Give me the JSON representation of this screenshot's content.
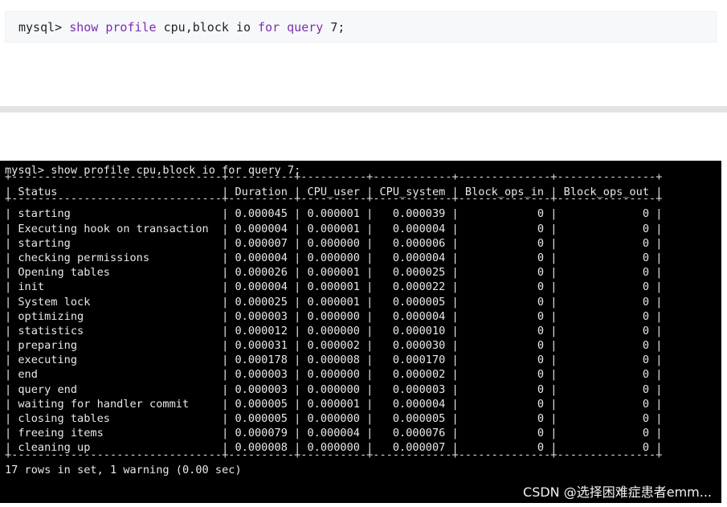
{
  "code_block": {
    "prompt": "mysql> ",
    "keyword_show": "show",
    "space1": " ",
    "keyword_profile": "profile",
    "args": " cpu,block io ",
    "keyword_for": "for",
    "space2": " ",
    "keyword_query": "query",
    "tail": " 7;"
  },
  "terminal": {
    "command_line": "mysql> show profile cpu,block io for query 7;",
    "separator_line": "+--------------------------------+----------+----------+------------+--------------+---------------+",
    "header_line": "| Status                         | Duration | CPU_user | CPU_system | Block_ops_in | Block_ops_out |",
    "rows": [
      "| starting                       | 0.000045 | 0.000001 |   0.000039 |            0 |             0 |",
      "| Executing hook on transaction  | 0.000004 | 0.000001 |   0.000004 |            0 |             0 |",
      "| starting                       | 0.000007 | 0.000000 |   0.000006 |            0 |             0 |",
      "| checking permissions           | 0.000004 | 0.000000 |   0.000004 |            0 |             0 |",
      "| Opening tables                 | 0.000026 | 0.000001 |   0.000025 |            0 |             0 |",
      "| init                           | 0.000004 | 0.000001 |   0.000022 |            0 |             0 |",
      "| System lock                    | 0.000025 | 0.000001 |   0.000005 |            0 |             0 |",
      "| optimizing                     | 0.000003 | 0.000000 |   0.000004 |            0 |             0 |",
      "| statistics                     | 0.000012 | 0.000000 |   0.000010 |            0 |             0 |",
      "| preparing                      | 0.000031 | 0.000002 |   0.000030 |            0 |             0 |",
      "| executing                      | 0.000178 | 0.000008 |   0.000170 |            0 |             0 |",
      "| end                            | 0.000003 | 0.000000 |   0.000002 |            0 |             0 |",
      "| query end                      | 0.000003 | 0.000000 |   0.000003 |            0 |             0 |",
      "| waiting for handler commit     | 0.000005 | 0.000001 |   0.000004 |            0 |             0 |",
      "| closing tables                 | 0.000005 | 0.000000 |   0.000005 |            0 |             0 |",
      "| freeing items                  | 0.000079 | 0.000004 |   0.000076 |            0 |             0 |",
      "| cleaning up                    | 0.000008 | 0.000000 |   0.000007 |            0 |             0 |"
    ],
    "footer_line": "17 rows in set, 1 warning (0.00 sec)",
    "watermark": "CSDN @选择困难症患者emm..."
  }
}
